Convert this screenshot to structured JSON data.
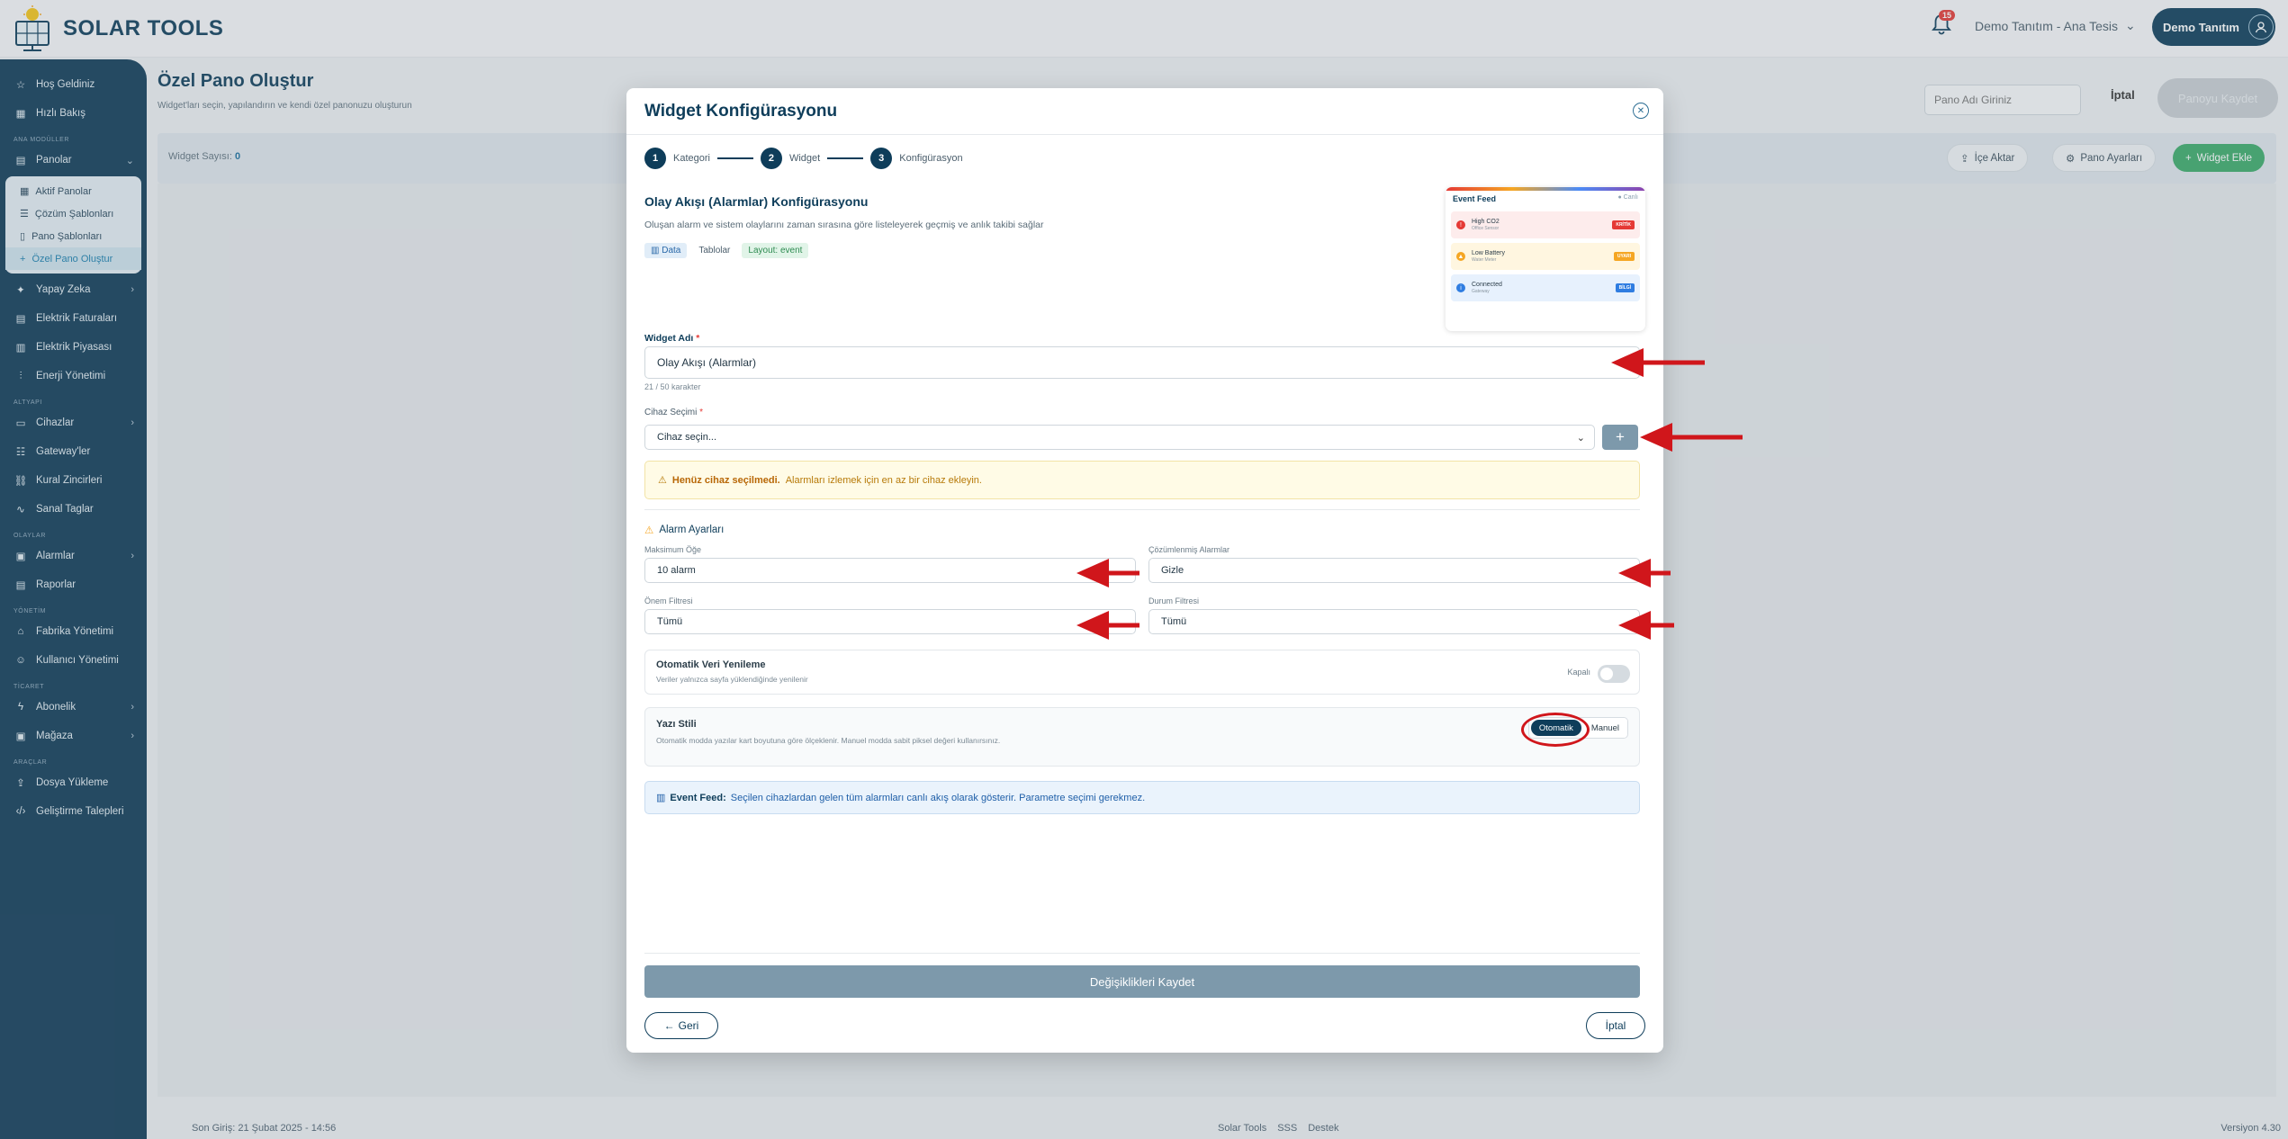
{
  "app": {
    "name": "SOLAR TOOLS",
    "notif_count": "15",
    "tenant": "Demo Tanıtım - Ana Tesis",
    "user": "Demo Tanıtım"
  },
  "sidebar": {
    "top_items": [
      {
        "label": "Hoş Geldiniz",
        "icon": "star-icon"
      },
      {
        "label": "Hızlı Bakış",
        "icon": "grid-icon"
      }
    ],
    "sections": {
      "main_modules": "ANA MODÜLLER",
      "infrastructure": "ALTYAPI",
      "alerts": "OLAYLAR",
      "management": "YÖNETİM",
      "commerce": "TİCARET",
      "tools": "ARAÇLAR"
    },
    "panolar": "Panolar",
    "pano_sub": [
      "Aktif Panolar",
      "Çözüm Şablonları",
      "Pano Şablonları",
      "Özel Pano Oluştur"
    ],
    "main_items": [
      "Yapay Zeka",
      "Elektrik Faturaları",
      "Elektrik Piyasası",
      "Enerji Yönetimi"
    ],
    "infra_items": [
      "Cihazlar",
      "Gateway'ler",
      "Kural Zincirleri",
      "Sanal Taglar"
    ],
    "alert_items": [
      "Alarmlar",
      "Raporlar"
    ],
    "mgmt_items": [
      "Fabrika Yönetimi",
      "Kullanıcı Yönetimi"
    ],
    "commerce_items": [
      "Abonelik",
      "Mağaza"
    ],
    "tool_items": [
      "Dosya Yükleme",
      "Geliştirme Talepleri"
    ]
  },
  "page": {
    "title": "Özel Pano Oluştur",
    "subtitle": "Widget'ları seçin, yapılandırın ve kendi özel panonuzu oluşturun",
    "name_placeholder": "Pano Adı Giriniz",
    "cancel": "İptal",
    "save": "Panoyu Kaydet",
    "widget_count_label": "Widget Sayısı:",
    "widget_count": "0",
    "import": "İçe Aktar",
    "settings": "Pano Ayarları",
    "add_widget": "Widget Ekle"
  },
  "footer": {
    "last_login": "Son Giriş: 21 Şubat 2025 - 14:56",
    "links": [
      "Solar Tools",
      "SSS",
      "Destek"
    ],
    "version": "Versiyon 4.30"
  },
  "modal": {
    "title": "Widget Konfigürasyonu",
    "steps": [
      {
        "num": "1",
        "label": "Kategori"
      },
      {
        "num": "2",
        "label": "Widget"
      },
      {
        "num": "3",
        "label": "Konfigürasyon"
      }
    ],
    "config_title": "Olay Akışı (Alarmlar) Konfigürasyonu",
    "config_desc": "Oluşan alarm ve sistem olaylarını zaman sırasına göre listeleyerek geçmiş ve anlık takibi sağlar",
    "tags": [
      "Data",
      "Tablolar",
      "Layout: event"
    ],
    "preview": {
      "title": "Event Feed",
      "live": "● Canlı",
      "rows": [
        {
          "title": "High CO2",
          "sub": "Office Sensor",
          "badge": "KRİTİK",
          "color": "#e53935"
        },
        {
          "title": "Low Battery",
          "sub": "Water Meter",
          "badge": "UYARI",
          "color": "#f5a623"
        },
        {
          "title": "Connected",
          "sub": "Gateway",
          "badge": "BİLGİ",
          "color": "#2f7de1"
        }
      ]
    },
    "widget_name_label": "Widget Adı",
    "widget_name_value": "Olay Akışı (Alarmlar)",
    "char_counter": "21 / 50 karakter",
    "device_label": "Cihaz Seçimi",
    "device_placeholder": "Cihaz seçin...",
    "warning_bold": "Henüz cihaz seçilmedi.",
    "warning_text": "Alarmları izlemek için en az bir cihaz ekleyin.",
    "alarm_section": "Alarm Ayarları",
    "max_items_label": "Maksimum Öğe",
    "max_items_value": "10 alarm",
    "resolved_label": "Çözümlenmiş Alarmlar",
    "resolved_value": "Gizle",
    "severity_label": "Önem Filtresi",
    "severity_value": "Tümü",
    "status_label": "Durum Filtresi",
    "status_value": "Tümü",
    "auto_refresh_title": "Otomatik Veri Yenileme",
    "auto_refresh_desc": "Veriler yalnızca sayfa yüklendiğinde yenilenir",
    "auto_refresh_state": "Kapalı",
    "font_style_title": "Yazı Stili",
    "font_style_desc": "Otomatik modda yazılar kart boyutuna göre ölçeklenir. Manuel modda sabit piksel değeri kullanırsınız.",
    "font_auto": "Otomatik",
    "font_manual": "Manuel",
    "info_bold": "Event Feed:",
    "info_text": "Seçilen cihazlardan gelen tüm alarmları canlı akış olarak gösterir. Parametre seçimi gerekmez.",
    "save_changes": "Değişiklikleri Kaydet",
    "back": "Geri",
    "cancel": "İptal"
  },
  "colors": {
    "primary": "#0e3d5a",
    "accent_green": "#3cab6a",
    "annotation_red": "#d0161b"
  }
}
